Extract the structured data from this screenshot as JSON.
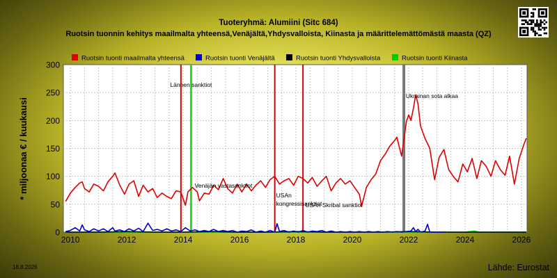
{
  "header": {
    "title": "Tuoteryhmä: Alumiini (Sitc 684)",
    "subtitle": "Ruotsin tuonnin kehitys maailmalta yhteensä,Venäjältä,Yhdysvalloista, Kiinasta ja määrittelemättömästä maasta (QZ)"
  },
  "footer": {
    "date": "18.8.2026",
    "source": "Lähde: Eurostat"
  },
  "chart_data": {
    "type": "line",
    "title": "Tuoteryhmä: Alumiini (Sitc 684)",
    "subtitle": "Ruotsin tuonnin kehitys maailmalta yhteensä,Venäjältä,Yhdysvalloista, Kiinasta ja määrittelemättömästä maasta (QZ)",
    "xlabel": "",
    "ylabel": "* miljoonaa € / kuukausi",
    "xlim": [
      2009.75,
      2026.2
    ],
    "ylim": [
      0,
      300
    ],
    "xticks": [
      2010,
      2012,
      2014,
      2016,
      2018,
      2020,
      2022,
      2024,
      2026
    ],
    "yticks": [
      0,
      50,
      100,
      150,
      200,
      250,
      300
    ],
    "grid": true,
    "legend_position": "top",
    "series": [
      {
        "name": "Ruotsin tuonti maailmalta yhteensä",
        "color": "#dd0000",
        "points": [
          [
            2009.83,
            55
          ],
          [
            2010.0,
            70
          ],
          [
            2010.17,
            80
          ],
          [
            2010.33,
            88
          ],
          [
            2010.42,
            90
          ],
          [
            2010.5,
            78
          ],
          [
            2010.67,
            72
          ],
          [
            2010.83,
            86
          ],
          [
            2011.0,
            82
          ],
          [
            2011.17,
            74
          ],
          [
            2011.33,
            90
          ],
          [
            2011.5,
            100
          ],
          [
            2011.58,
            106
          ],
          [
            2011.75,
            84
          ],
          [
            2011.92,
            68
          ],
          [
            2012.08,
            86
          ],
          [
            2012.25,
            92
          ],
          [
            2012.42,
            64
          ],
          [
            2012.58,
            84
          ],
          [
            2012.75,
            72
          ],
          [
            2012.92,
            78
          ],
          [
            2013.08,
            62
          ],
          [
            2013.25,
            70
          ],
          [
            2013.42,
            64
          ],
          [
            2013.58,
            60
          ],
          [
            2013.75,
            74
          ],
          [
            2013.92,
            72
          ],
          [
            2014.08,
            48
          ],
          [
            2014.17,
            72
          ],
          [
            2014.33,
            80
          ],
          [
            2014.5,
            72
          ],
          [
            2014.58,
            56
          ],
          [
            2014.75,
            70
          ],
          [
            2014.92,
            68
          ],
          [
            2015.08,
            84
          ],
          [
            2015.25,
            76
          ],
          [
            2015.42,
            96
          ],
          [
            2015.58,
            78
          ],
          [
            2015.75,
            70
          ],
          [
            2015.92,
            86
          ],
          [
            2016.08,
            72
          ],
          [
            2016.25,
            86
          ],
          [
            2016.42,
            74
          ],
          [
            2016.58,
            84
          ],
          [
            2016.75,
            92
          ],
          [
            2016.92,
            80
          ],
          [
            2017.08,
            94
          ],
          [
            2017.25,
            100
          ],
          [
            2017.42,
            86
          ],
          [
            2017.58,
            92
          ],
          [
            2017.75,
            96
          ],
          [
            2017.92,
            84
          ],
          [
            2018.08,
            100
          ],
          [
            2018.25,
            96
          ],
          [
            2018.42,
            88
          ],
          [
            2018.58,
            98
          ],
          [
            2018.75,
            82
          ],
          [
            2018.92,
            92
          ],
          [
            2019.08,
            100
          ],
          [
            2019.25,
            74
          ],
          [
            2019.42,
            88
          ],
          [
            2019.58,
            96
          ],
          [
            2019.75,
            86
          ],
          [
            2019.92,
            92
          ],
          [
            2020.08,
            80
          ],
          [
            2020.25,
            68
          ],
          [
            2020.33,
            46
          ],
          [
            2020.5,
            80
          ],
          [
            2020.67,
            94
          ],
          [
            2020.83,
            104
          ],
          [
            2021.0,
            128
          ],
          [
            2021.17,
            140
          ],
          [
            2021.33,
            154
          ],
          [
            2021.5,
            164
          ],
          [
            2021.58,
            170
          ],
          [
            2021.75,
            136
          ],
          [
            2021.92,
            198
          ],
          [
            2022.0,
            210
          ],
          [
            2022.08,
            200
          ],
          [
            2022.17,
            222
          ],
          [
            2022.25,
            246
          ],
          [
            2022.33,
            230
          ],
          [
            2022.42,
            190
          ],
          [
            2022.58,
            168
          ],
          [
            2022.75,
            150
          ],
          [
            2022.92,
            94
          ],
          [
            2023.08,
            134
          ],
          [
            2023.25,
            148
          ],
          [
            2023.42,
            112
          ],
          [
            2023.58,
            100
          ],
          [
            2023.75,
            90
          ],
          [
            2023.92,
            122
          ],
          [
            2024.08,
            108
          ],
          [
            2024.25,
            132
          ],
          [
            2024.42,
            96
          ],
          [
            2024.58,
            128
          ],
          [
            2024.75,
            118
          ],
          [
            2024.92,
            100
          ],
          [
            2025.08,
            128
          ],
          [
            2025.25,
            112
          ],
          [
            2025.42,
            102
          ],
          [
            2025.58,
            136
          ],
          [
            2025.75,
            86
          ],
          [
            2025.92,
            132
          ],
          [
            2026.08,
            156
          ],
          [
            2026.17,
            168
          ]
        ]
      },
      {
        "name": "Ruotsin tuonti Venäjältä",
        "color": "#0000cc",
        "points": [
          [
            2009.83,
            1
          ],
          [
            2010.0,
            3
          ],
          [
            2010.17,
            8
          ],
          [
            2010.33,
            2
          ],
          [
            2010.42,
            13
          ],
          [
            2010.5,
            4
          ],
          [
            2010.67,
            1
          ],
          [
            2010.83,
            6
          ],
          [
            2011.0,
            2
          ],
          [
            2011.17,
            6
          ],
          [
            2011.33,
            1
          ],
          [
            2011.5,
            8
          ],
          [
            2011.58,
            2
          ],
          [
            2011.75,
            4
          ],
          [
            2011.92,
            1
          ],
          [
            2012.08,
            6
          ],
          [
            2012.25,
            2
          ],
          [
            2012.42,
            7
          ],
          [
            2012.58,
            1
          ],
          [
            2012.75,
            16
          ],
          [
            2012.92,
            3
          ],
          [
            2013.08,
            5
          ],
          [
            2013.25,
            2
          ],
          [
            2013.42,
            6
          ],
          [
            2013.58,
            2
          ],
          [
            2013.75,
            4
          ],
          [
            2013.92,
            1
          ],
          [
            2014.08,
            8
          ],
          [
            2014.25,
            2
          ],
          [
            2014.42,
            4
          ],
          [
            2014.58,
            1
          ],
          [
            2014.75,
            3
          ],
          [
            2014.92,
            1
          ],
          [
            2015.08,
            5
          ],
          [
            2015.25,
            1
          ],
          [
            2015.42,
            3
          ],
          [
            2015.58,
            1
          ],
          [
            2015.75,
            3
          ],
          [
            2015.92,
            0
          ],
          [
            2016.08,
            2
          ],
          [
            2016.25,
            1
          ],
          [
            2016.42,
            4
          ],
          [
            2016.58,
            0
          ],
          [
            2016.75,
            2
          ],
          [
            2016.92,
            0
          ],
          [
            2017.08,
            3
          ],
          [
            2017.25,
            0
          ],
          [
            2017.33,
            15
          ],
          [
            2017.42,
            1
          ],
          [
            2017.58,
            3
          ],
          [
            2017.75,
            0
          ],
          [
            2017.92,
            2
          ],
          [
            2018.08,
            0
          ],
          [
            2018.25,
            3
          ],
          [
            2018.42,
            0
          ],
          [
            2018.58,
            2
          ],
          [
            2018.75,
            1
          ],
          [
            2018.92,
            3
          ],
          [
            2019.08,
            0
          ],
          [
            2019.25,
            2
          ],
          [
            2019.42,
            0
          ],
          [
            2019.58,
            1
          ],
          [
            2019.75,
            0
          ],
          [
            2019.92,
            1
          ],
          [
            2020.08,
            0
          ],
          [
            2020.25,
            1
          ],
          [
            2020.42,
            0
          ],
          [
            2020.58,
            1
          ],
          [
            2020.75,
            0
          ],
          [
            2020.92,
            1
          ],
          [
            2021.08,
            0
          ],
          [
            2021.25,
            1
          ],
          [
            2021.42,
            0
          ],
          [
            2021.58,
            1
          ],
          [
            2021.75,
            0
          ],
          [
            2021.92,
            1
          ],
          [
            2022.08,
            2
          ],
          [
            2022.17,
            8
          ],
          [
            2022.25,
            1
          ],
          [
            2022.33,
            5
          ],
          [
            2022.42,
            0
          ],
          [
            2022.58,
            2
          ],
          [
            2022.67,
            14
          ],
          [
            2022.75,
            0
          ],
          [
            2022.92,
            0
          ],
          [
            2023.08,
            0
          ],
          [
            2023.25,
            0
          ]
        ]
      },
      {
        "name": "Ruotsin tuonti Yhdysvalloista",
        "color": "#000000",
        "points": [
          [
            2009.83,
            0
          ],
          [
            2011.0,
            0
          ],
          [
            2012.0,
            1
          ],
          [
            2013.0,
            0
          ],
          [
            2014.0,
            0
          ],
          [
            2015.0,
            1
          ],
          [
            2016.0,
            0
          ],
          [
            2017.0,
            0
          ],
          [
            2018.0,
            1
          ],
          [
            2019.0,
            0
          ],
          [
            2020.0,
            0
          ],
          [
            2021.0,
            0
          ],
          [
            2022.0,
            1
          ],
          [
            2023.0,
            0
          ],
          [
            2024.0,
            0
          ],
          [
            2025.0,
            0
          ],
          [
            2026.17,
            0
          ]
        ]
      },
      {
        "name": "Ruotsin tuonti Kiinasta",
        "color": "#00cc00",
        "points": [
          [
            2009.83,
            0
          ],
          [
            2012.0,
            0
          ],
          [
            2014.0,
            0
          ],
          [
            2016.0,
            0
          ],
          [
            2018.0,
            0
          ],
          [
            2020.0,
            0
          ],
          [
            2022.0,
            0
          ],
          [
            2024.0,
            0
          ],
          [
            2024.33,
            2
          ],
          [
            2024.5,
            0
          ],
          [
            2026.17,
            0
          ]
        ]
      }
    ],
    "annotations": [
      {
        "x": 2013.92,
        "color": "#dd0000",
        "label": ""
      },
      {
        "x": 2014.28,
        "color": "#22dd22",
        "label": "Lännen sanktiot"
      },
      {
        "x": 2014.28,
        "color": "",
        "label": "Venäjän vastasanktiot"
      },
      {
        "x": 2017.25,
        "color": "#dd0000",
        "label": "USAn kongressisanktiot"
      },
      {
        "x": 2018.25,
        "color": "#dd0000",
        "label": "USAn Skribal sanktiot"
      },
      {
        "x": 2021.83,
        "color": "#777777",
        "label": "Ukrainan sota alkaa"
      }
    ]
  }
}
